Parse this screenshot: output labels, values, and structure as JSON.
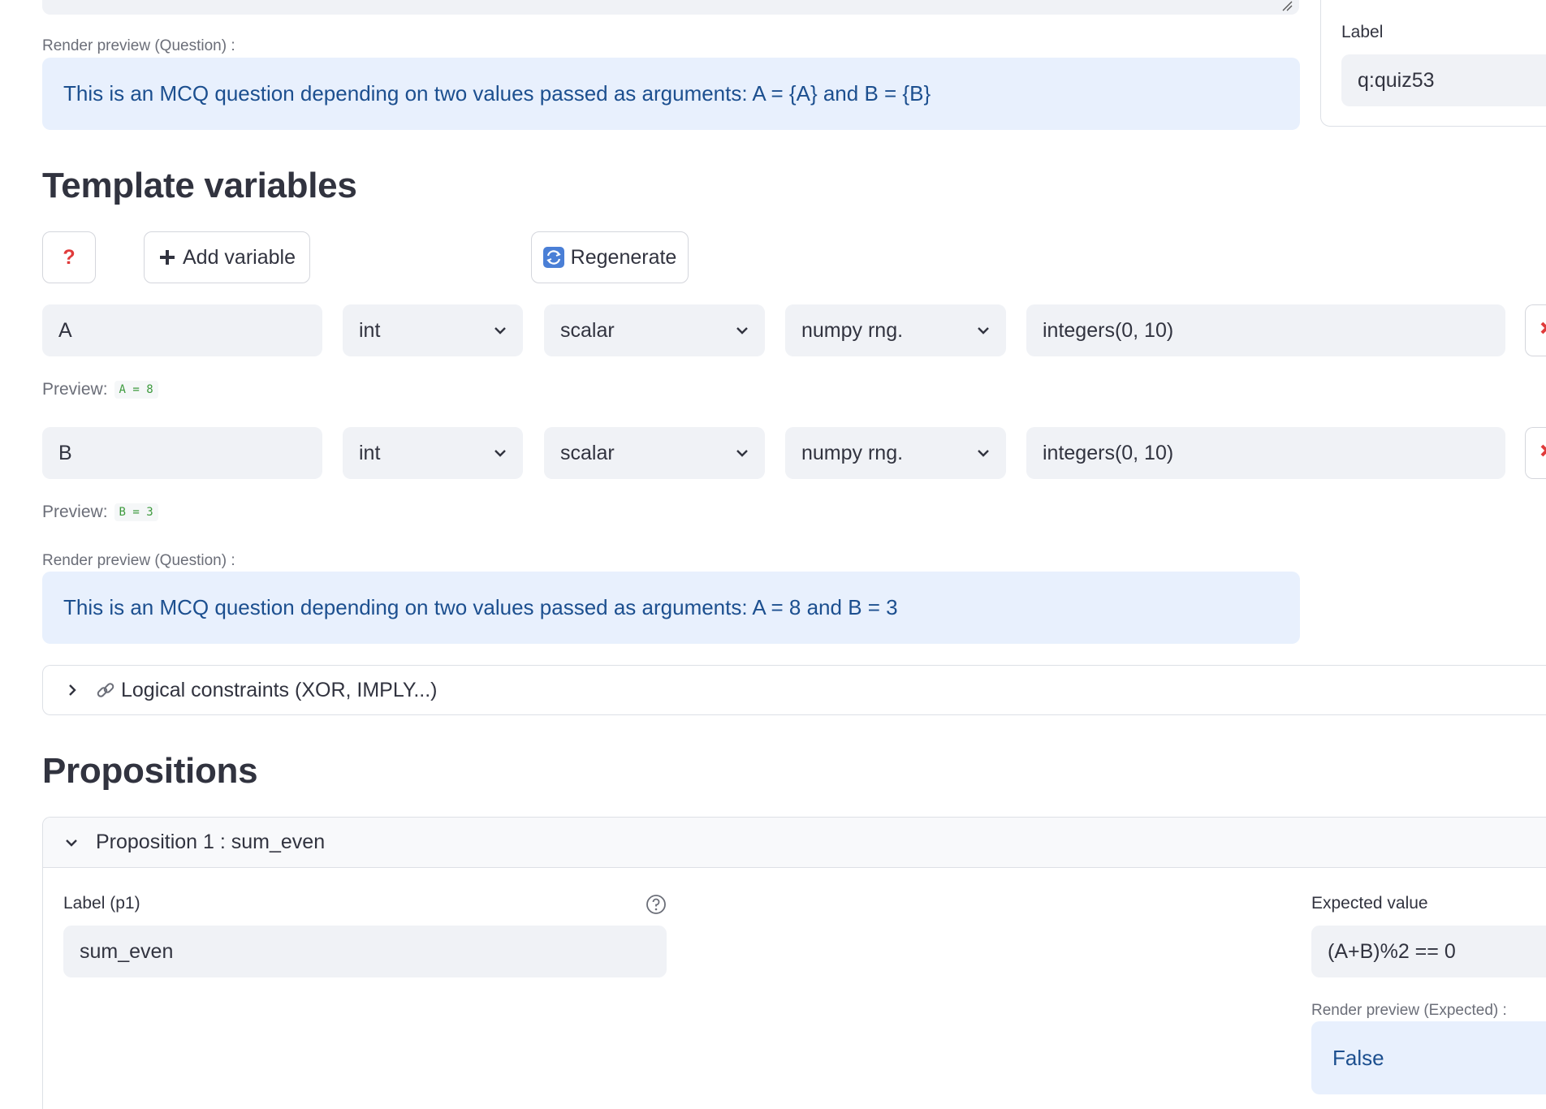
{
  "question_section": {
    "render_preview_label": "Render preview (Question) :",
    "render_preview_text": "This is an MCQ question depending on two values passed as arguments: A = {A} and B = {B}"
  },
  "right_card": {
    "label_title": "Label",
    "label_value": "q:quiz53"
  },
  "template_variables": {
    "heading": "Template variables",
    "help_button": "?",
    "add_button": "Add variable",
    "regenerate_button": "Regenerate",
    "preview_prefix": "Preview:",
    "variables": [
      {
        "name": "A",
        "dtype": "int",
        "shape": "scalar",
        "generator": "numpy rng.",
        "expression": "integers(0, 10)",
        "preview": "A = 8"
      },
      {
        "name": "B",
        "dtype": "int",
        "shape": "scalar",
        "generator": "numpy rng.",
        "expression": "integers(0, 10)",
        "preview": "B = 3"
      }
    ],
    "render_preview_label": "Render preview (Question) :",
    "render_preview_text": "This is an MCQ question depending on two values passed as arguments: A = 8 and B = 3",
    "logical_constraints": "Logical constraints (XOR, IMPLY...)"
  },
  "propositions": {
    "heading": "Propositions",
    "items": [
      {
        "header": "Proposition 1 : sum_even",
        "label_title": "Label (p1)",
        "label_value": "sum_even",
        "expected_title": "Expected value",
        "expected_value": "(A+B)%2 == 0",
        "render_expected_label": "Render preview (Expected) :",
        "render_expected_value": "False"
      }
    ]
  },
  "colors": {
    "accent_blue_text": "#1c4f8f",
    "preview_bg": "#e8f0fd",
    "input_bg": "#f0f2f6",
    "help_red": "#e03b3b",
    "code_green": "#3d9a3d"
  }
}
